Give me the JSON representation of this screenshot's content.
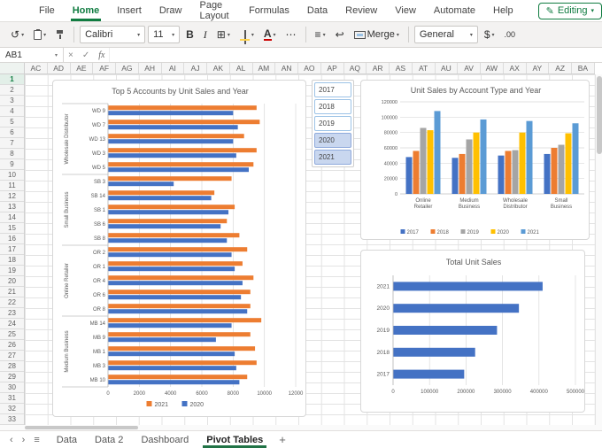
{
  "colors": {
    "excel_green": "#107C41",
    "sheet_green": "#217346",
    "axis_text": "#595959",
    "gridline": "#d9d9d9",
    "series_blue": "#4472C4",
    "series_orange": "#ED7D31",
    "series_gray": "#A5A5A5",
    "series_yellow": "#FFC000",
    "series_lightblue": "#5B9BD5"
  },
  "icons": {
    "undo": "↺",
    "chevron_down": "▾",
    "borders": "⊞",
    "more": "⋯",
    "align": "≡",
    "wrap": "↩",
    "cancel": "×",
    "confirm": "✓",
    "pencil": "✎",
    "nav_left": "‹",
    "nav_right": "›",
    "all_sheets": "≡"
  },
  "menu": {
    "tabs": [
      "File",
      "Home",
      "Insert",
      "Draw",
      "Page Layout",
      "Formulas",
      "Data",
      "Review",
      "View",
      "Automate",
      "Help"
    ],
    "active_tab": "Home",
    "editing_button": "Editing"
  },
  "toolbar": {
    "font_name": "Calibri",
    "font_size": "11",
    "bold_label": "B",
    "italic_label": "I",
    "font_color_label": "A",
    "merge_label": "Merge",
    "number_format": "General",
    "currency_label": "$",
    "decimals_label": ".00"
  },
  "formula_bar": {
    "name_box": "AB1",
    "fx_label": "fx",
    "formula_value": ""
  },
  "grid": {
    "columns": [
      "AC",
      "AD",
      "AE",
      "AF",
      "AG",
      "AH",
      "AI",
      "AJ",
      "AK",
      "AL",
      "AM",
      "AN",
      "AO",
      "AP",
      "AQ",
      "AR",
      "AS",
      "AT",
      "AU",
      "AV",
      "AW",
      "AX",
      "AY",
      "AZ",
      "BA"
    ],
    "rows": [
      "1",
      "2",
      "3",
      "4",
      "5",
      "6",
      "7",
      "8",
      "9",
      "10",
      "11",
      "12",
      "13",
      "14",
      "15",
      "16",
      "17",
      "18",
      "19",
      "20",
      "21",
      "22",
      "23",
      "24",
      "25",
      "26",
      "27",
      "28",
      "29",
      "30",
      "31",
      "32",
      "33"
    ],
    "selected_row": "1"
  },
  "slicer": {
    "items": [
      {
        "label": "2017",
        "selected": false
      },
      {
        "label": "2018",
        "selected": false
      },
      {
        "label": "2019",
        "selected": false
      },
      {
        "label": "2020",
        "selected": true
      },
      {
        "label": "2021",
        "selected": true
      }
    ]
  },
  "sheet_bar": {
    "tabs": [
      "Data",
      "Data 2",
      "Dashboard",
      "Pivot Tables"
    ],
    "active_tab": "Pivot Tables",
    "add_label": "+"
  },
  "chart_data": [
    {
      "type": "bar",
      "orientation": "horizontal",
      "title": "Top 5 Accounts by Unit Sales and Year",
      "groups": [
        {
          "label": "Wholesale Distributor",
          "categories": [
            "WD 9",
            "WD 7",
            "WD 13",
            "WD 3",
            "WD 5"
          ]
        },
        {
          "label": "Small Business",
          "categories": [
            "SB 3",
            "SB 14",
            "SB 1",
            "SB 6",
            "SB 8"
          ]
        },
        {
          "label": "Online Retailer",
          "categories": [
            "OR 2",
            "OR 1",
            "OR 4",
            "OR 6",
            "OR 8"
          ]
        },
        {
          "label": "Medium Business",
          "categories": [
            "MB 14",
            "MB 9",
            "MB 1",
            "MB 3",
            "MB 10"
          ]
        }
      ],
      "series": [
        {
          "name": "2021",
          "color": "#ED7D31",
          "values": [
            9500,
            9700,
            8700,
            9500,
            9300,
            7900,
            6800,
            8100,
            7600,
            8400,
            8900,
            8600,
            9300,
            9100,
            9100,
            9800,
            9100,
            9400,
            9500,
            8900
          ]
        },
        {
          "name": "2020",
          "color": "#4472C4",
          "values": [
            8000,
            8300,
            8000,
            8200,
            9000,
            4200,
            6600,
            7700,
            7200,
            7600,
            7900,
            8100,
            8600,
            8500,
            8900,
            7900,
            6900,
            8100,
            8200,
            8400
          ]
        }
      ],
      "xlim": [
        0,
        12000
      ],
      "xticks": [
        0,
        2000,
        4000,
        6000,
        8000,
        10000,
        12000
      ],
      "legend_position": "bottom"
    },
    {
      "type": "bar",
      "orientation": "vertical",
      "title": "Unit Sales by Account Type and Year",
      "categories": [
        "Online Retailer",
        "Medium Business",
        "Wholesale Distributor",
        "Small Business"
      ],
      "series": [
        {
          "name": "2017",
          "color": "#4472C4",
          "values": [
            48000,
            47000,
            50000,
            52000
          ]
        },
        {
          "name": "2018",
          "color": "#ED7D31",
          "values": [
            56000,
            52000,
            56000,
            60000
          ]
        },
        {
          "name": "2019",
          "color": "#A5A5A5",
          "values": [
            86000,
            71000,
            57000,
            64000
          ]
        },
        {
          "name": "2020",
          "color": "#FFC000",
          "values": [
            83000,
            80000,
            80000,
            79000
          ]
        },
        {
          "name": "2021",
          "color": "#5B9BD5",
          "values": [
            108000,
            97000,
            95000,
            92000
          ]
        }
      ],
      "ylim": [
        0,
        120000
      ],
      "yticks": [
        0,
        20000,
        40000,
        60000,
        80000,
        100000,
        120000
      ],
      "legend_position": "bottom"
    },
    {
      "type": "bar",
      "orientation": "horizontal",
      "title": "Total Unit Sales",
      "categories": [
        "2021",
        "2020",
        "2019",
        "2018",
        "2017"
      ],
      "series": [
        {
          "name": "Total",
          "color": "#4472C4",
          "values": [
            410000,
            345000,
            285000,
            225000,
            195000
          ]
        }
      ],
      "xlim": [
        0,
        500000
      ],
      "xticks": [
        0,
        100000,
        200000,
        300000,
        400000,
        500000
      ],
      "legend_position": "none"
    }
  ]
}
